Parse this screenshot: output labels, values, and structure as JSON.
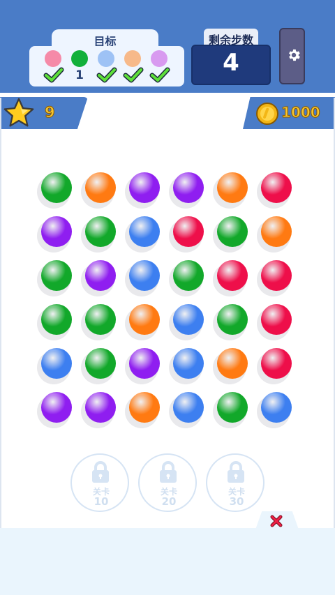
{
  "hud": {
    "goal_title": "目标",
    "moves_label": "剩余步数",
    "moves_value": "4",
    "stars": "9",
    "coins": "1000"
  },
  "goals": [
    {
      "color": "#f58aa8",
      "status": "done",
      "count": ""
    },
    {
      "color": "#12b03a",
      "status": "count",
      "count": "1"
    },
    {
      "color": "#9ec2f5",
      "status": "done",
      "count": ""
    },
    {
      "color": "#f7b98a",
      "status": "done",
      "count": ""
    },
    {
      "color": "#d89af0",
      "status": "done",
      "count": ""
    }
  ],
  "palette": {
    "green": "#12a82a",
    "orange": "#ff7a12",
    "purple": "#8f1ef0",
    "red": "#ee0f4a",
    "blue": "#3d7ff0"
  },
  "board": [
    [
      "green",
      "orange",
      "purple",
      "purple",
      "orange",
      "red"
    ],
    [
      "purple",
      "green",
      "blue",
      "red",
      "green",
      "orange"
    ],
    [
      "green",
      "purple",
      "blue",
      "green",
      "red",
      "red"
    ],
    [
      "green",
      "green",
      "orange",
      "blue",
      "green",
      "red"
    ],
    [
      "blue",
      "green",
      "purple",
      "blue",
      "orange",
      "red"
    ],
    [
      "purple",
      "purple",
      "orange",
      "blue",
      "green",
      "blue"
    ]
  ],
  "locked_levels": [
    {
      "label": "关卡",
      "number": "10"
    },
    {
      "label": "关卡",
      "number": "20"
    },
    {
      "label": "关卡",
      "number": "30"
    }
  ],
  "icons": {
    "settings": "gear-icon",
    "star": "star-icon",
    "coin": "coin-icon",
    "lock": "lock-icon",
    "close": "close-icon",
    "check": "check-icon"
  }
}
